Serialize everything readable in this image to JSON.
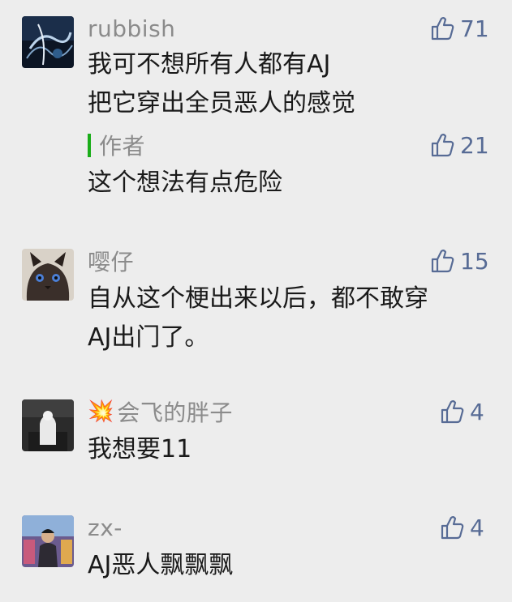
{
  "comments": [
    {
      "author": "rubbish",
      "likes": "71",
      "lines": [
        "我可不想所有人都有AJ",
        "把它穿出全员恶人的感觉"
      ],
      "reply": {
        "author": "作者",
        "likes": "21",
        "lines": [
          "这个想法有点危险"
        ]
      }
    },
    {
      "author": "嘤仔",
      "likes": "15",
      "lines": [
        "自从这个梗出来以后，都不敢穿",
        "AJ出门了。"
      ]
    },
    {
      "author": "会飞的胖子",
      "author_emoji": "💥",
      "likes": "4",
      "lines": [
        "我想要11"
      ]
    },
    {
      "author": "zx-",
      "likes": "4",
      "lines": [
        "AJ恶人飘飘飘"
      ]
    }
  ],
  "icons": {
    "like": "thumbs-up-outline-icon"
  },
  "colors": {
    "background": "#ededed",
    "name": "#8b8b8b",
    "like": "#576b95",
    "reply_bar": "#1aad19",
    "text": "#1a1a1a"
  }
}
